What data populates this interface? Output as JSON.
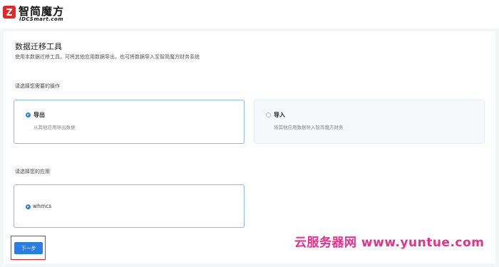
{
  "brand": {
    "name": "智简魔方",
    "sub": "IDCSmart.com"
  },
  "page": {
    "title": "数据迁移工具",
    "description": "使用本数据迁移工具，可将其他应用数据导出，也可将数据导入至智简魔方财务系统"
  },
  "operation": {
    "label": "请选择您需要的操作",
    "options": [
      {
        "title": "导出",
        "desc": "从其他应用导出数据",
        "selected": true
      },
      {
        "title": "导入",
        "desc": "将其他应用数据导入智简魔方财务",
        "selected": false
      }
    ]
  },
  "app": {
    "label": "请选择您的应用",
    "options": [
      {
        "label": "whmcs",
        "selected": true
      }
    ]
  },
  "actions": {
    "next_label": "下一步"
  },
  "watermark": "云服务器网 www.yuntue.com",
  "colors": {
    "accent": "#2a7de1",
    "brand_red": "#e4282a",
    "watermark": "#e8308a"
  }
}
